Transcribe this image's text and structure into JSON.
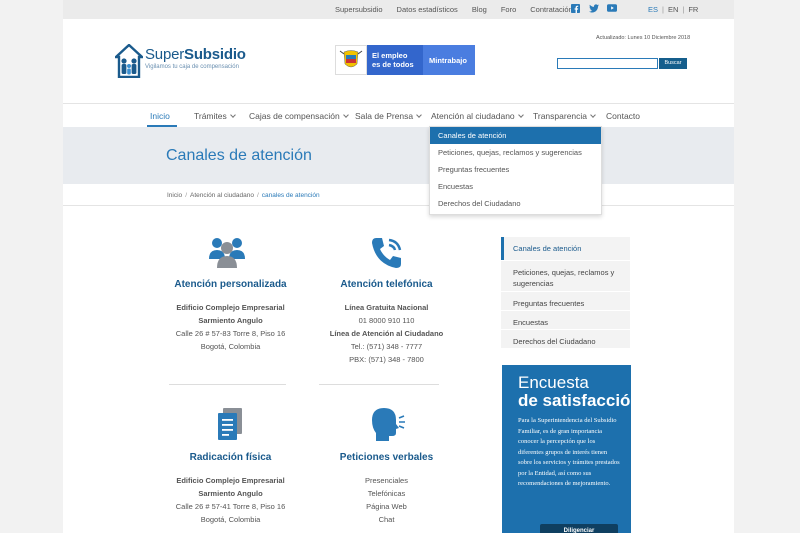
{
  "topbar": {
    "links": [
      "Supersubsidio",
      "Datos estadísticos",
      "Blog",
      "Foro",
      "Contratación"
    ],
    "languages": [
      "ES",
      "EN",
      "FR"
    ],
    "active_language": "ES",
    "social_icons": [
      "facebook-icon",
      "twitter-icon",
      "youtube-icon"
    ]
  },
  "header": {
    "logo_name_plain": "Super",
    "logo_name_bold": "Subsidio",
    "logo_tagline": "Vigilamos tu caja de compensación",
    "gov_line1": "El empleo",
    "gov_line2": "es de todos",
    "gov_ministry": "Mintrabajo",
    "updated": "Actualizado: Lunes 10 Diciembre 2018",
    "search_button": "Buscar",
    "search_value": ""
  },
  "nav": {
    "items": [
      "Inicio",
      "Trámites",
      "Cajas de compensación",
      "Sala de Prensa",
      "Atención al ciudadano",
      "Transparencia",
      "Contacto"
    ],
    "active": "Inicio"
  },
  "dropdown": {
    "items": [
      "Canales de atención",
      "Peticiones, quejas, reclamos y sugerencias",
      "Preguntas frecuentes",
      "Encuestas",
      "Derechos del Ciudadano"
    ],
    "active": "Canales de atención"
  },
  "page": {
    "title": "Canales de atención",
    "breadcrumb": [
      "Inicio",
      "Atención al ciudadano",
      "canales de atención"
    ]
  },
  "blocks": [
    {
      "title": "Atención personalizada",
      "icon": "people-icon",
      "lines": [
        "Edificio Complejo Empresarial",
        "Sarmiento Angulo",
        "Calle 26 # 57-83 Torre 8, Piso 16",
        "Bogotá, Colombia"
      ]
    },
    {
      "title": "Atención telefónica",
      "icon": "phone-icon",
      "lines": [
        "Línea Gratuita Nacional",
        "01 8000 910 110",
        "Línea de Atención al Ciudadano",
        "Tel.: (571) 348 - 7777",
        "PBX: (571) 348 - 7800"
      ]
    },
    {
      "title": "Radicación física",
      "icon": "document-icon",
      "lines": [
        "Edificio Complejo Empresarial",
        "Sarmiento Angulo",
        "Calle 26 # 57-41 Torre 8, Piso 16",
        "Bogotá, Colombia"
      ]
    },
    {
      "title": "Peticiones verbales",
      "icon": "speaking-head-icon",
      "lines": [
        "Presenciales",
        "Telefónicas",
        "Página Web",
        "Chat"
      ]
    }
  ],
  "sidebar": {
    "items": [
      "Canales de atención",
      "Peticiones, quejas, reclamos y sugerencias",
      "Preguntas frecuentes",
      "Encuestas",
      "Derechos del Ciudadano"
    ],
    "active": "Canales de atención"
  },
  "survey": {
    "title_light": "Encuesta",
    "title_bold": "de satisfacción",
    "text": "Para la Superintendencia del Subsidio Familiar, es de gran importancia conocer la percepción que los diferentes grupos de interés tienen sobre los servicios y trámites prestados por la Entidad, así como sus recomendaciones de mejoramiento.",
    "button": "Diligenciar"
  },
  "colors": {
    "accent": "#2a7ab8",
    "dark_blue": "#1a5a8c",
    "survey_bg": "#1d70ad",
    "title_band": "#e8ebef"
  }
}
